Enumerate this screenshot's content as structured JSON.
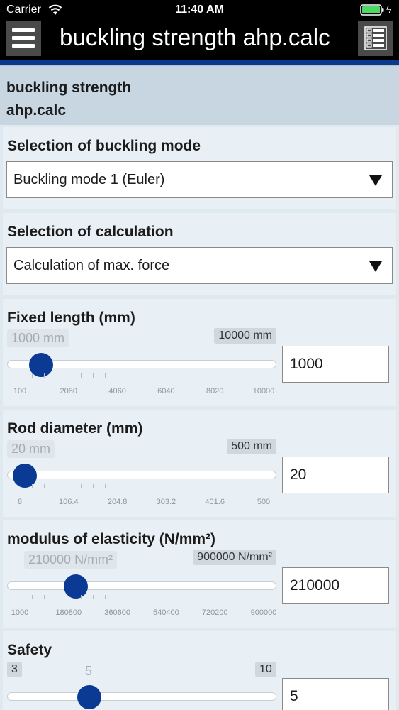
{
  "status": {
    "carrier": "Carrier",
    "time": "11:40 AM"
  },
  "nav": {
    "title": "buckling strength ahp.calc"
  },
  "page": {
    "title_line1": "buckling strength",
    "title_line2": "ahp.calc"
  },
  "buckling_mode": {
    "label": "Selection of buckling mode",
    "selected": "Buckling mode 1 (Euler)"
  },
  "calculation": {
    "label": "Selection of calculation",
    "selected": "Calculation of max. force"
  },
  "sliders": [
    {
      "label": "Fixed length (mm)",
      "current_label": "1000 mm",
      "max_label": "10000 mm",
      "ticks": [
        "100",
        "2080",
        "4060",
        "6040",
        "8020",
        "10000"
      ],
      "value": "1000",
      "fraction": 0.091
    },
    {
      "label": "Rod diameter (mm)",
      "current_label": "20 mm",
      "max_label": "500 mm",
      "ticks": [
        "8",
        "106.4",
        "204.8",
        "303.2",
        "401.6",
        "500"
      ],
      "value": "20",
      "fraction": 0.024
    },
    {
      "label": "modulus of elasticity (N/mm²)",
      "current_label": "210000 N/mm²",
      "max_label": "900000 N/mm²",
      "ticks": [
        "1000",
        "180800",
        "360600",
        "540400",
        "720200",
        "900000"
      ],
      "value": "210000",
      "fraction": 0.232
    },
    {
      "label": "Safety",
      "min_label": "3",
      "current_label": "5",
      "max_label": "10",
      "value": "5",
      "fraction": 0.286
    }
  ],
  "colors": {
    "accent": "#0a3a8c",
    "thumb": "#0b3a95",
    "header_bg": "#c7d6e1",
    "card_bg": "#e9f0f5"
  }
}
